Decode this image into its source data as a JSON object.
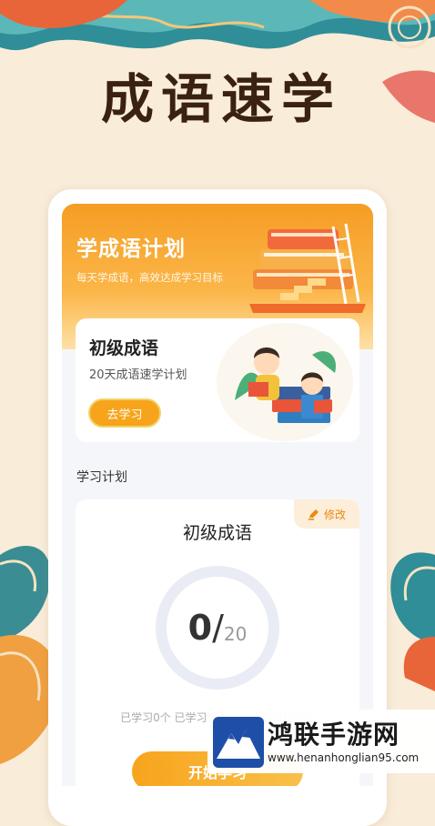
{
  "promo": {
    "title": "成语速学"
  },
  "hero": {
    "title": "学成语计划",
    "subtitle": "每天学成语，高效达成学习目标",
    "illustration_icon": "books-stairs-icon"
  },
  "course": {
    "title": "初级成语",
    "subtitle": "20天成语速学计划",
    "button_label": "去学习",
    "illustration_icon": "kids-reading-icon"
  },
  "plan": {
    "section_label": "学习计划",
    "edit_label": "修改",
    "edit_icon": "pencil-icon",
    "title": "初级成语",
    "progress": {
      "current": "0",
      "separator": "/",
      "total": "20"
    },
    "stats": "已学习0个  已学习0天  预计4月30日学完",
    "start_label": "开始学习"
  },
  "watermark": {
    "name": "鸿联手游网",
    "url": "www.henanhonglian95.com",
    "logo_icon": "mountain-logo-icon"
  },
  "colors": {
    "accent": "#f7a41c",
    "background": "#f9ecd9"
  }
}
